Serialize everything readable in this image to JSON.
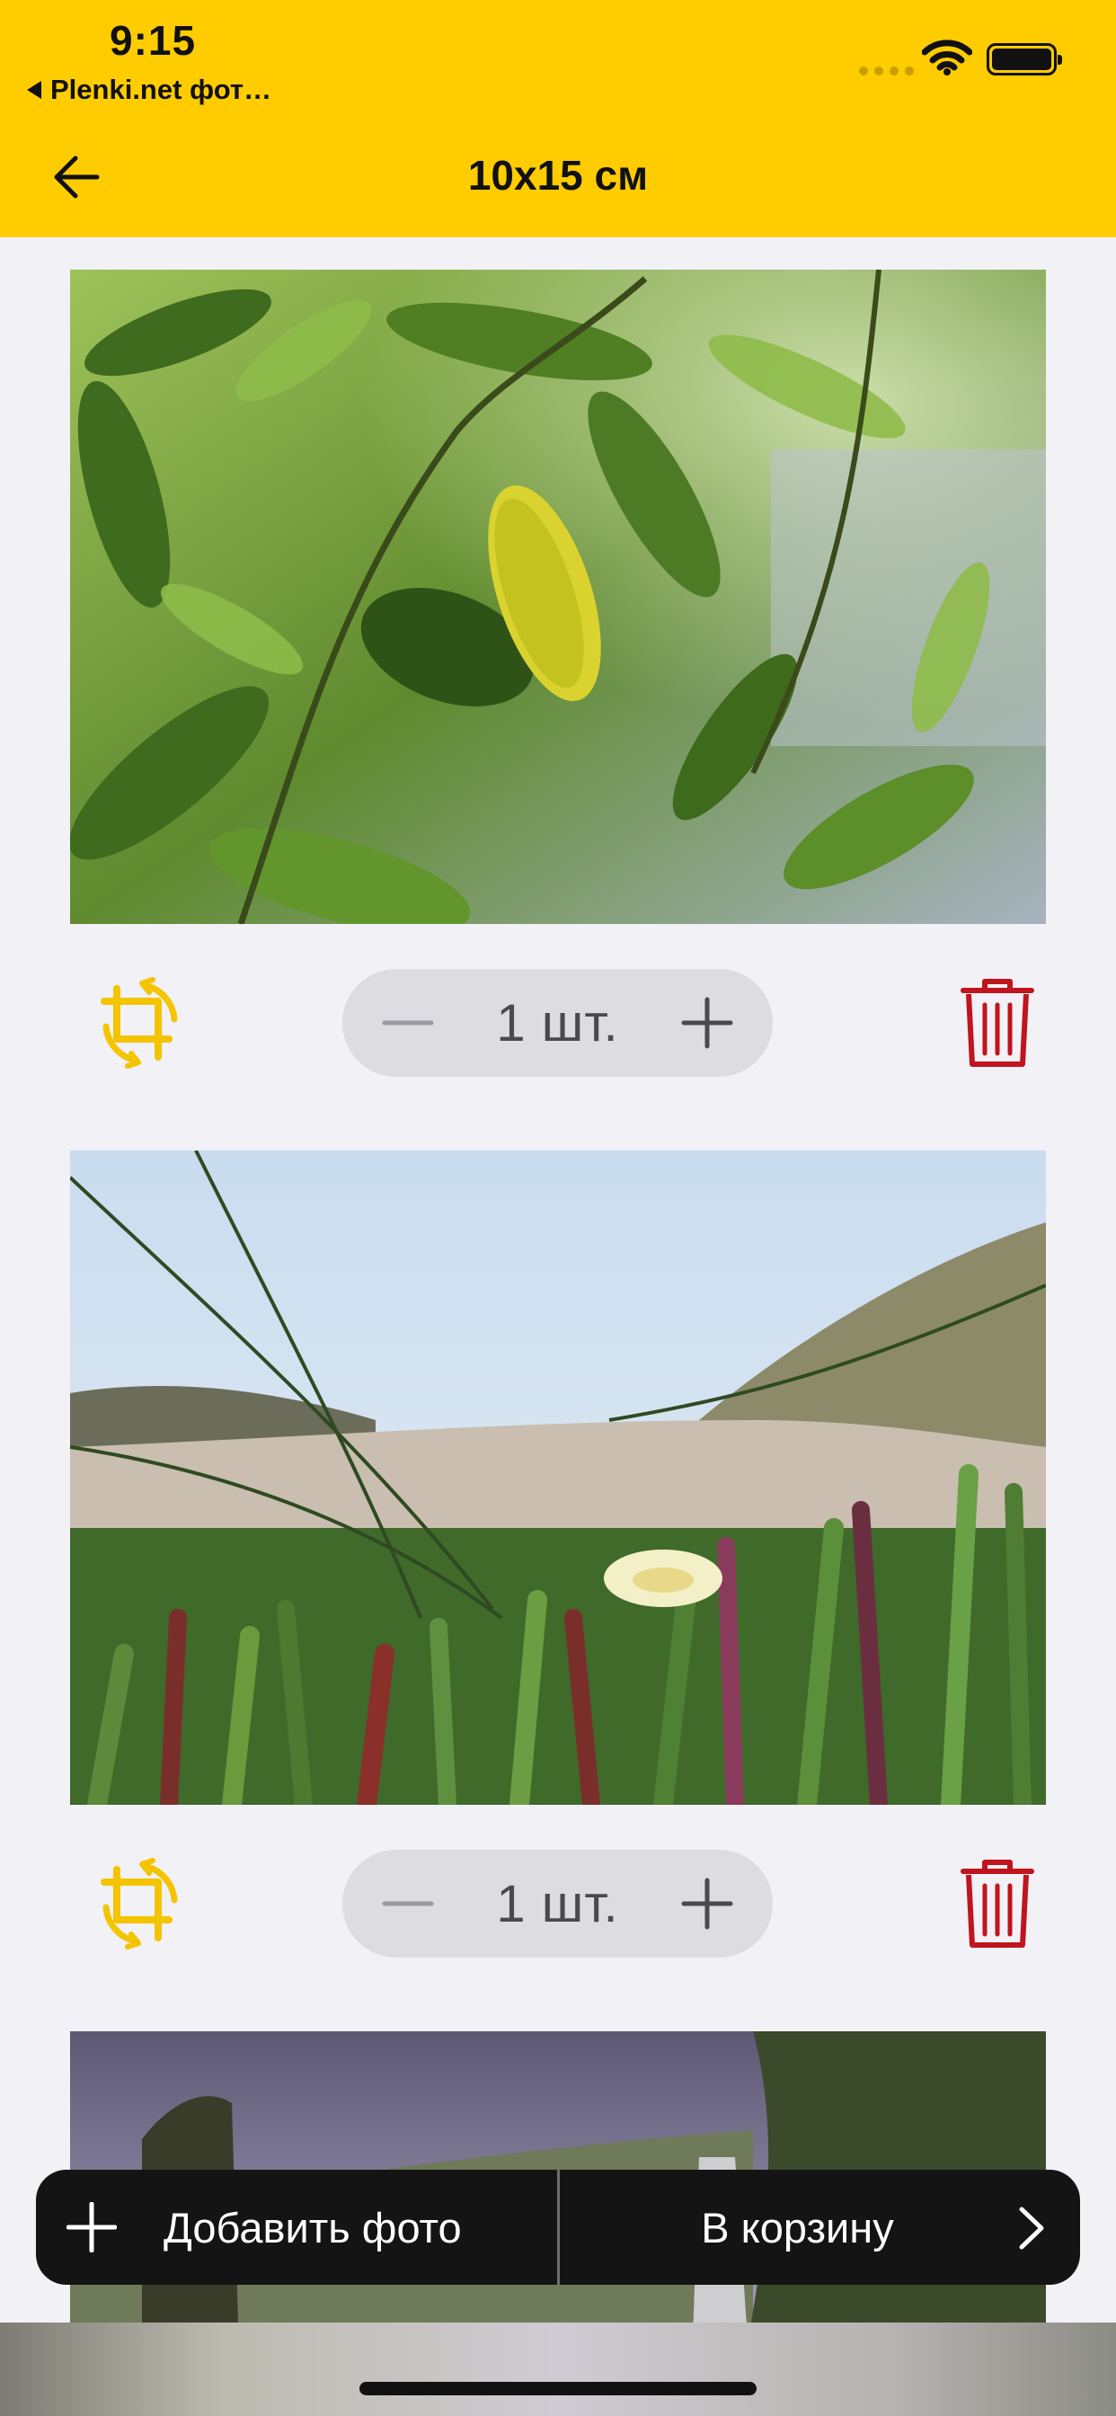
{
  "status_bar": {
    "time": "9:15",
    "back_app_label": "Plenki.net фот…"
  },
  "nav": {
    "title": "10x15 см",
    "back_icon": "arrow-left-icon"
  },
  "items": [
    {
      "quantity_label": "1 шт.",
      "crop_icon": "crop-rotate-icon",
      "delete_icon": "trash-icon"
    },
    {
      "quantity_label": "1 шт.",
      "crop_icon": "crop-rotate-icon",
      "delete_icon": "trash-icon"
    }
  ],
  "action_bar": {
    "add_photo_label": "Добавить фото",
    "to_cart_label": "В корзину"
  },
  "colors": {
    "accent": "#FFCC00",
    "delete": "#C0141E",
    "background": "#F1F1F6",
    "action_bar": "#141414"
  }
}
